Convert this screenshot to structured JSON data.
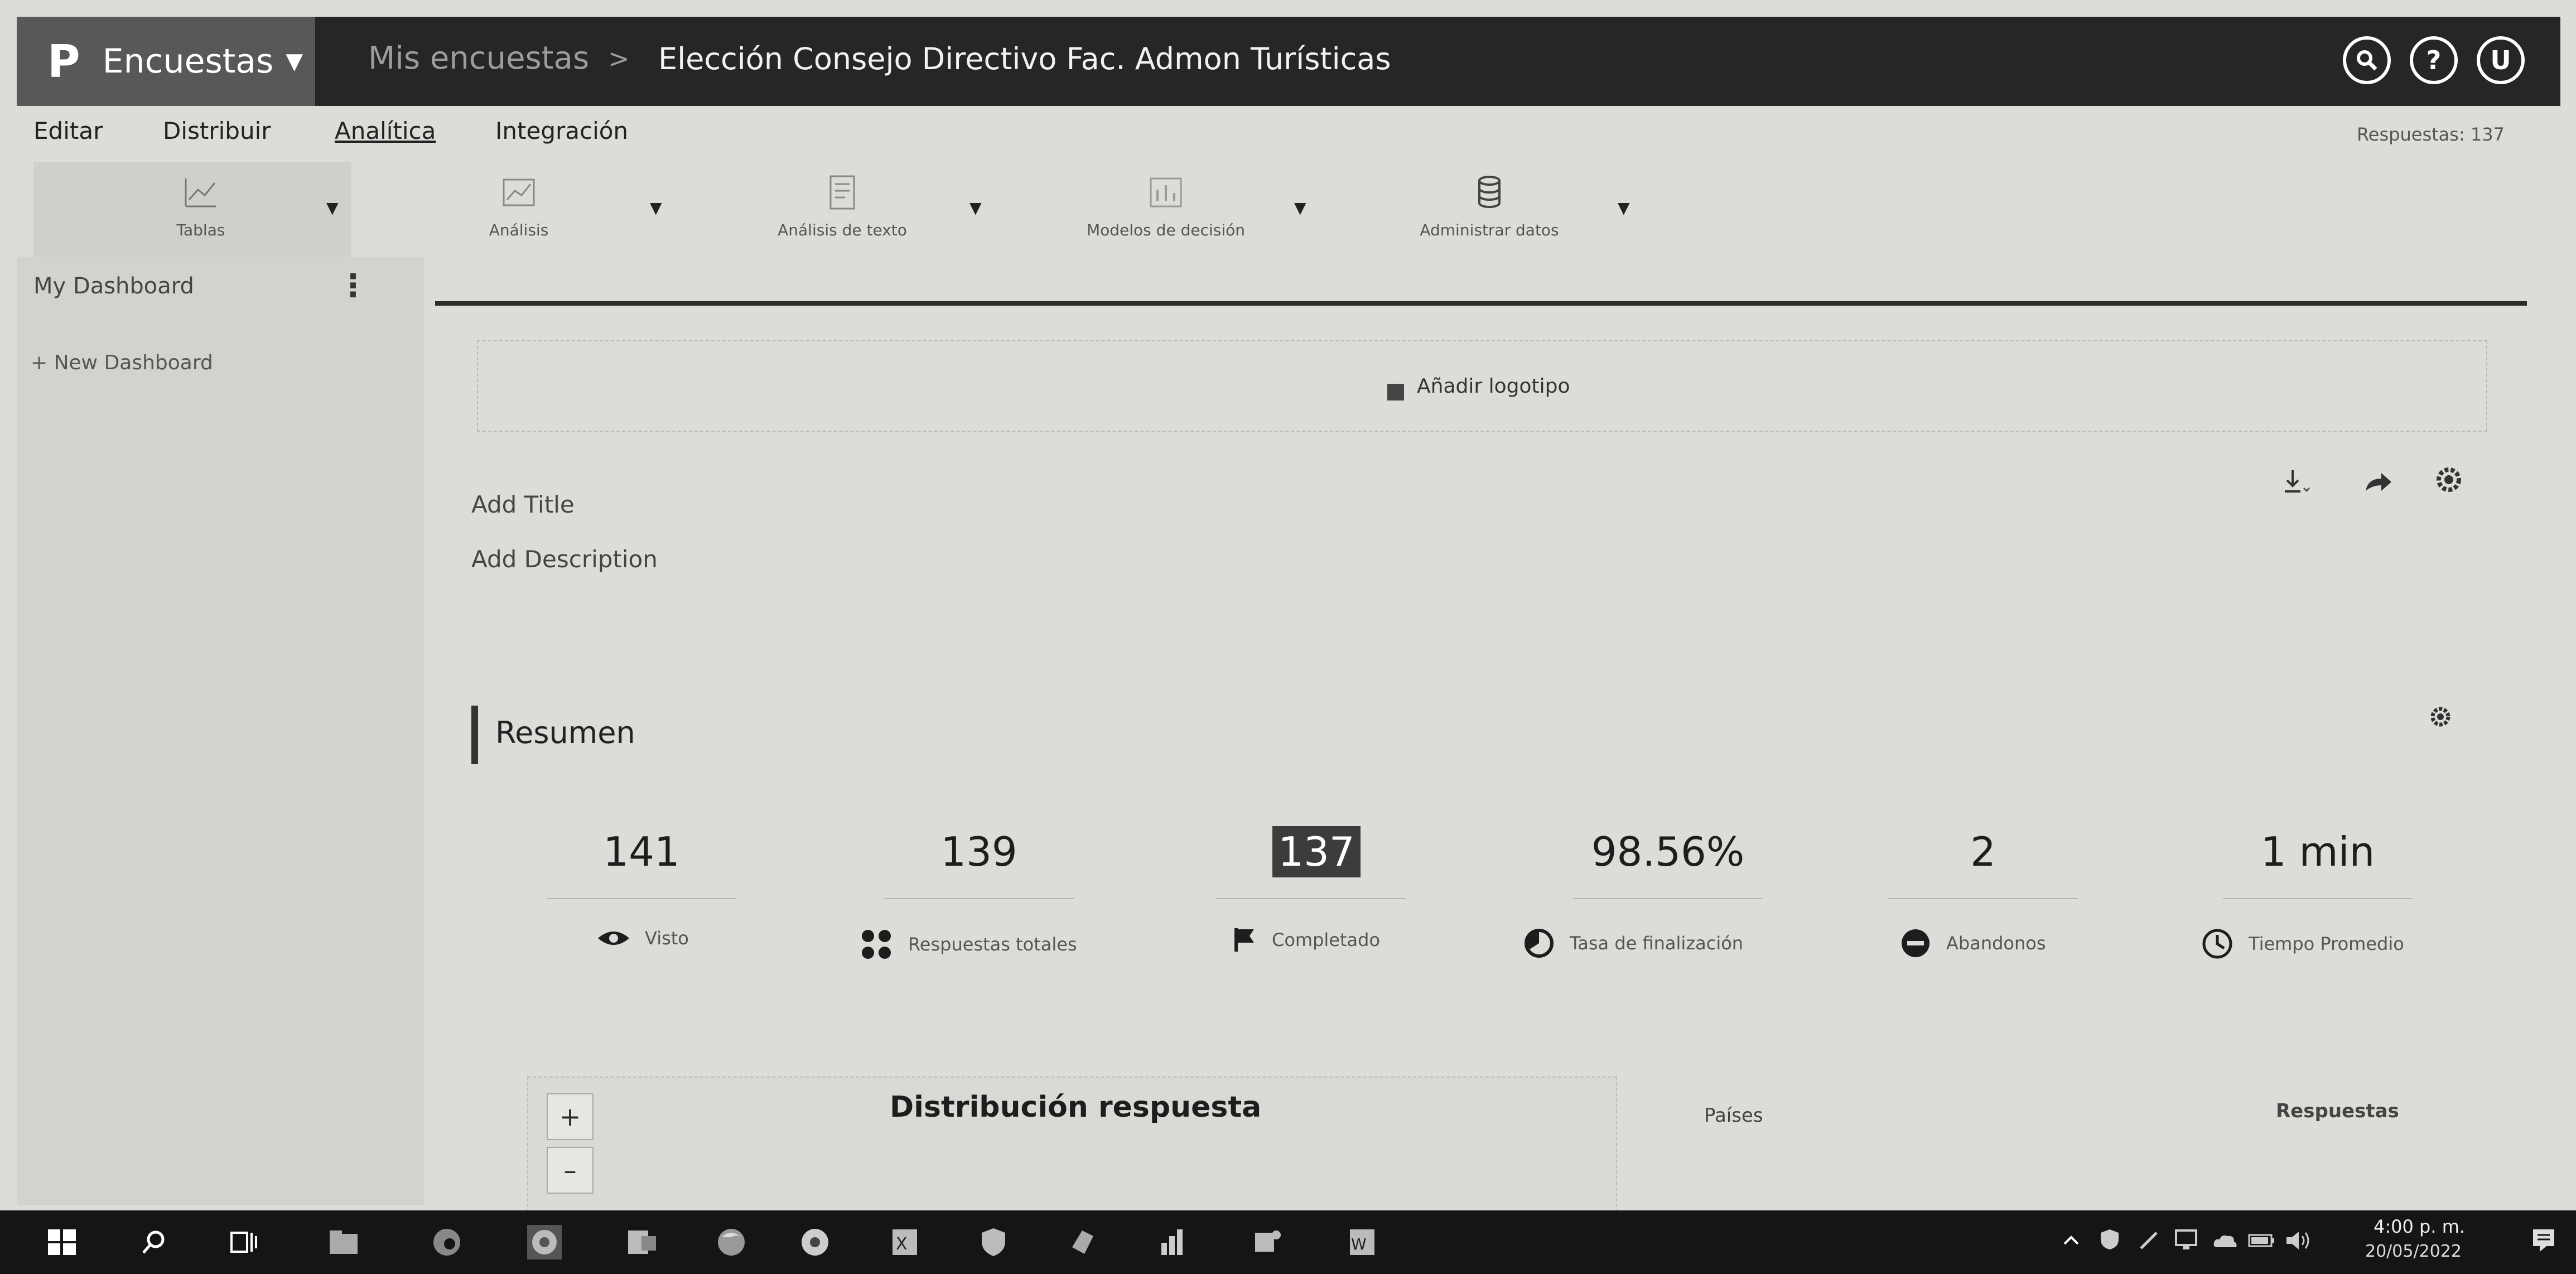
{
  "topbar": {
    "brand_logo": "P",
    "app_name": "Encuestas",
    "breadcrumb_parent": "Mis encuestas",
    "breadcrumb_separator": ">",
    "survey_title": "Elección Consejo Directivo Fac. Admon Turísticas",
    "icons": [
      "search-icon",
      "help-icon",
      "user-avatar"
    ],
    "help_label": "?",
    "user_initial": "U"
  },
  "menu": {
    "items": [
      "Editar",
      "Distribuir",
      "Analítica",
      "Integración"
    ],
    "active": "Analítica",
    "responses_label": "Respuestas: 137"
  },
  "toolbar": {
    "items": [
      "Tablas",
      "Análisis",
      "Análisis de texto",
      "Modelos de decisión",
      "Administrar datos"
    ]
  },
  "sidebar": {
    "dashboard_label": "My Dashboard",
    "kebab": "⋮",
    "new_dashboard_label": "+ New Dashboard"
  },
  "main": {
    "add_logo_label": "Añadir logotipo",
    "add_title": "Add Title",
    "add_description": "Add Description"
  },
  "summary": {
    "title": "Resumen",
    "stats": [
      {
        "value": "141",
        "label": "Visto"
      },
      {
        "value": "139",
        "label": "Respuestas totales"
      },
      {
        "value": "137",
        "label": "Completado"
      },
      {
        "value": "98.56%",
        "label": "Tasa de finalización"
      },
      {
        "value": "2",
        "label": "Abandonos"
      },
      {
        "value": "1 min",
        "label": "Tiempo Promedio"
      }
    ]
  },
  "chart_panel": {
    "title": "Distribución respuesta",
    "zoom_in": "+",
    "zoom_out": "–"
  },
  "table_panel": {
    "col_countries": "Países",
    "col_responses": "Respuestas"
  },
  "taskbar": {
    "time": "4:00 p. m.",
    "date": "20/05/2022"
  },
  "colors": {
    "topbar": "#262626",
    "brand": "#585858",
    "accent_dark": "#3c3c3c"
  }
}
